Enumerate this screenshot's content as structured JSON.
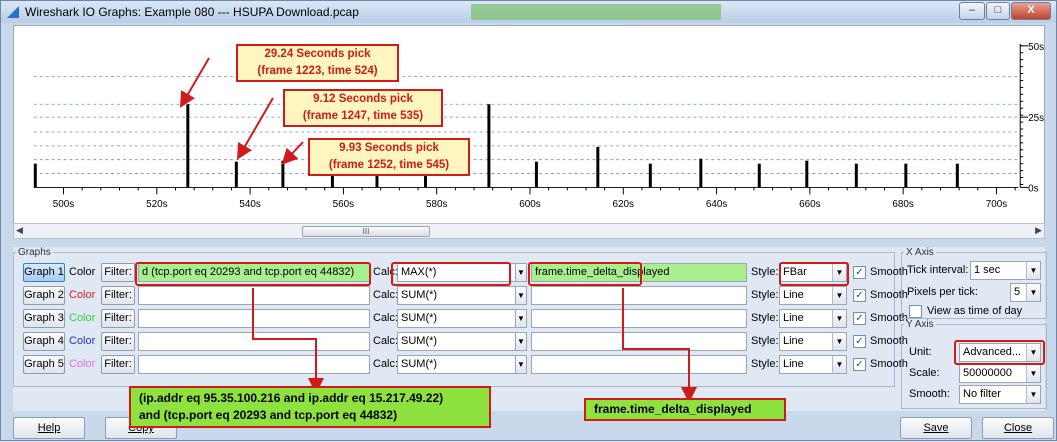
{
  "window": {
    "title": "Wireshark IO Graphs: Example 080 --- HSUPA Download.pcap",
    "minimize": "–",
    "maximize": "□",
    "close": "X"
  },
  "plot": {
    "y_ticks": [
      "50s",
      "25s",
      "0s"
    ],
    "x_ticks": [
      "500s",
      "520s",
      "540s",
      "560s",
      "580s",
      "600s",
      "620s",
      "640s",
      "660s",
      "680s",
      "700s"
    ],
    "bar_color": "#000000",
    "grid_color": "#6c8fd6"
  },
  "callouts": {
    "c1": {
      "line1": "29.24 Seconds pick",
      "line2": "(frame 1223, time 524)"
    },
    "c2": {
      "line1": "9.12 Seconds pick",
      "line2": "(frame 1247, time 535)"
    },
    "c3": {
      "line1": "9.93 Seconds pick",
      "line2": "(frame 1252, time 545)"
    }
  },
  "graphs": {
    "section_label": "Graphs",
    "color_label": "Color",
    "filter_label": "Filter:",
    "calc_label": "Calc:",
    "style_label": "Style:",
    "smooth_label": "Smooth",
    "rows": [
      {
        "name": "Graph 1",
        "color": "#000000",
        "filter": "d (tcp.port eq 20293 and tcp.port eq 44832)",
        "calc": "MAX(*)",
        "field": "frame.time_delta_displayed",
        "style": "FBar",
        "smooth": true
      },
      {
        "name": "Graph 2",
        "color": "#e02020",
        "filter": "",
        "calc": "SUM(*)",
        "field": "",
        "style": "Line",
        "smooth": true
      },
      {
        "name": "Graph 3",
        "color": "#3cc83c",
        "filter": "",
        "calc": "SUM(*)",
        "field": "",
        "style": "Line",
        "smooth": true
      },
      {
        "name": "Graph 4",
        "color": "#2030e0",
        "filter": "",
        "calc": "SUM(*)",
        "field": "",
        "style": "Line",
        "smooth": true
      },
      {
        "name": "Graph 5",
        "color": "#e070e0",
        "filter": "",
        "calc": "SUM(*)",
        "field": "",
        "style": "Line",
        "smooth": true
      }
    ]
  },
  "filter_note": {
    "line1": "(ip.addr eq 95.35.100.216 and ip.addr eq 15.217.49.22)",
    "line2": "and (tcp.port eq 20293 and tcp.port eq 44832)"
  },
  "field_note": "frame.time_delta_displayed",
  "x_axis": {
    "label": "X Axis",
    "tick_interval_label": "Tick interval:",
    "tick_interval": "1 sec",
    "pixels_per_tick_label": "Pixels per tick:",
    "pixels_per_tick": "5",
    "view_time_of_day": "View as time of day"
  },
  "y_axis": {
    "label": "Y Axis",
    "unit_label": "Unit:",
    "unit": "Advanced...",
    "scale_label": "Scale:",
    "scale": "50000000",
    "smooth_label": "Smooth:",
    "smooth": "No filter"
  },
  "footer": {
    "help": "Help",
    "copy": "Copy",
    "save": "Save",
    "close": "Close"
  }
}
